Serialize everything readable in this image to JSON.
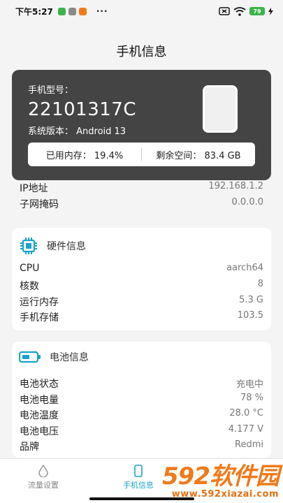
{
  "status_bar": {
    "time": "下午5:27",
    "dots": "···",
    "battery": "79"
  },
  "header": {
    "title": "手机信息"
  },
  "device": {
    "model_label": "手机型号：",
    "model_value": "22101317C",
    "system_version": "系统版本：  Android 13",
    "memory_used": "已用内存：  19.4%",
    "storage_free": "剩余空间：  83.4 GB"
  },
  "network": {
    "rows": [
      {
        "label": "IP地址",
        "value": "192.168.1.2"
      },
      {
        "label": "子网掩码",
        "value": "0.0.0.0"
      }
    ]
  },
  "hardware": {
    "title": "硬件信息",
    "rows": [
      {
        "label": "CPU",
        "value": "aarch64"
      },
      {
        "label": "核数",
        "value": "8"
      },
      {
        "label": "运行内存",
        "value": "5.3 G"
      },
      {
        "label": "手机存储",
        "value": "103.5"
      }
    ]
  },
  "battery": {
    "title": "电池信息",
    "rows": [
      {
        "label": "电池状态",
        "value": "充电中"
      },
      {
        "label": "电池电量",
        "value": "78 %"
      },
      {
        "label": "电池温度",
        "value": "28.0 °C"
      },
      {
        "label": "电池电压",
        "value": "4.177 V"
      },
      {
        "label": "品牌",
        "value": "Redmi"
      }
    ]
  },
  "bottom_nav": {
    "items": [
      {
        "label": "流量设置",
        "icon": "droplet-icon"
      },
      {
        "label": "手机信息",
        "icon": "phone-icon"
      }
    ]
  },
  "watermark": {
    "logo": "592软件园",
    "url": "www.592xiazai.com"
  },
  "colors": {
    "card_dark": "#444444",
    "accent": "#1aa3c8",
    "watermark": "#f07a1a"
  }
}
